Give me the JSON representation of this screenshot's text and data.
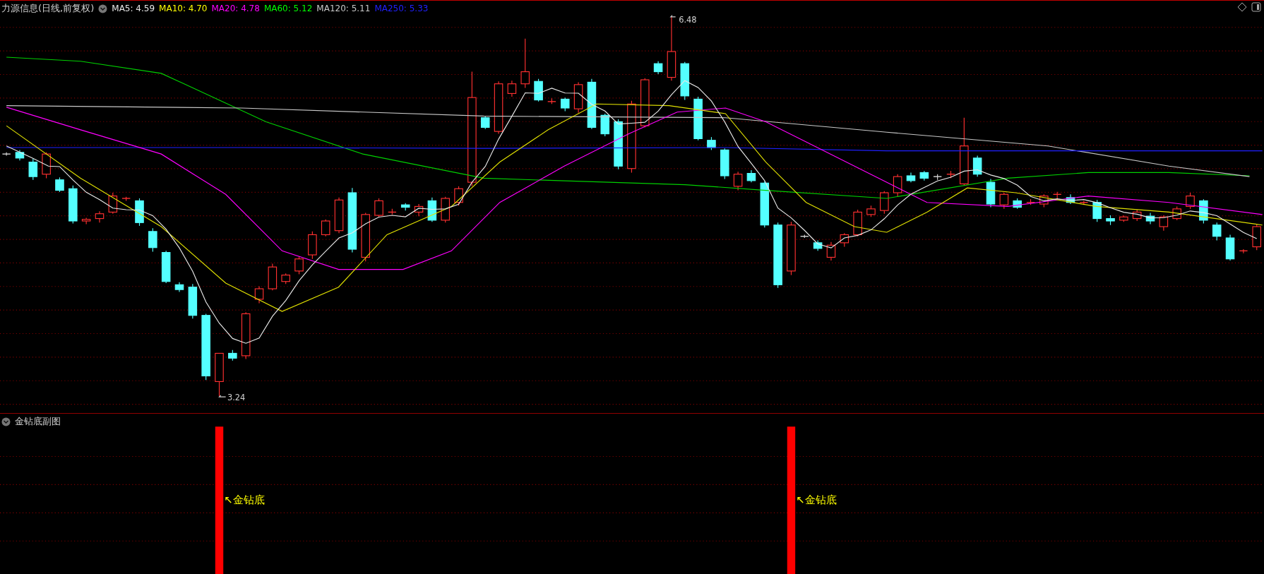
{
  "header": {
    "title": "力源信息(日线,前复权)",
    "indicators": [
      {
        "label": "MA5: 4.59",
        "color": "#e8e8e8"
      },
      {
        "label": "MA10: 4.70",
        "color": "#ffff00"
      },
      {
        "label": "MA20: 4.78",
        "color": "#ff00ff"
      },
      {
        "label": "MA60: 5.12",
        "color": "#00ff00"
      },
      {
        "label": "MA120: 5.11",
        "color": "#c8c8c8"
      },
      {
        "label": "MA250: 5.33",
        "color": "#2020ff"
      }
    ]
  },
  "main_chart": {
    "high_label": "6.48",
    "low_label": "3.24"
  },
  "sub_panel": {
    "title": "金钻底副图",
    "signals": [
      {
        "label": "↖金钻底"
      },
      {
        "label": "↖金钻底"
      }
    ]
  }
}
